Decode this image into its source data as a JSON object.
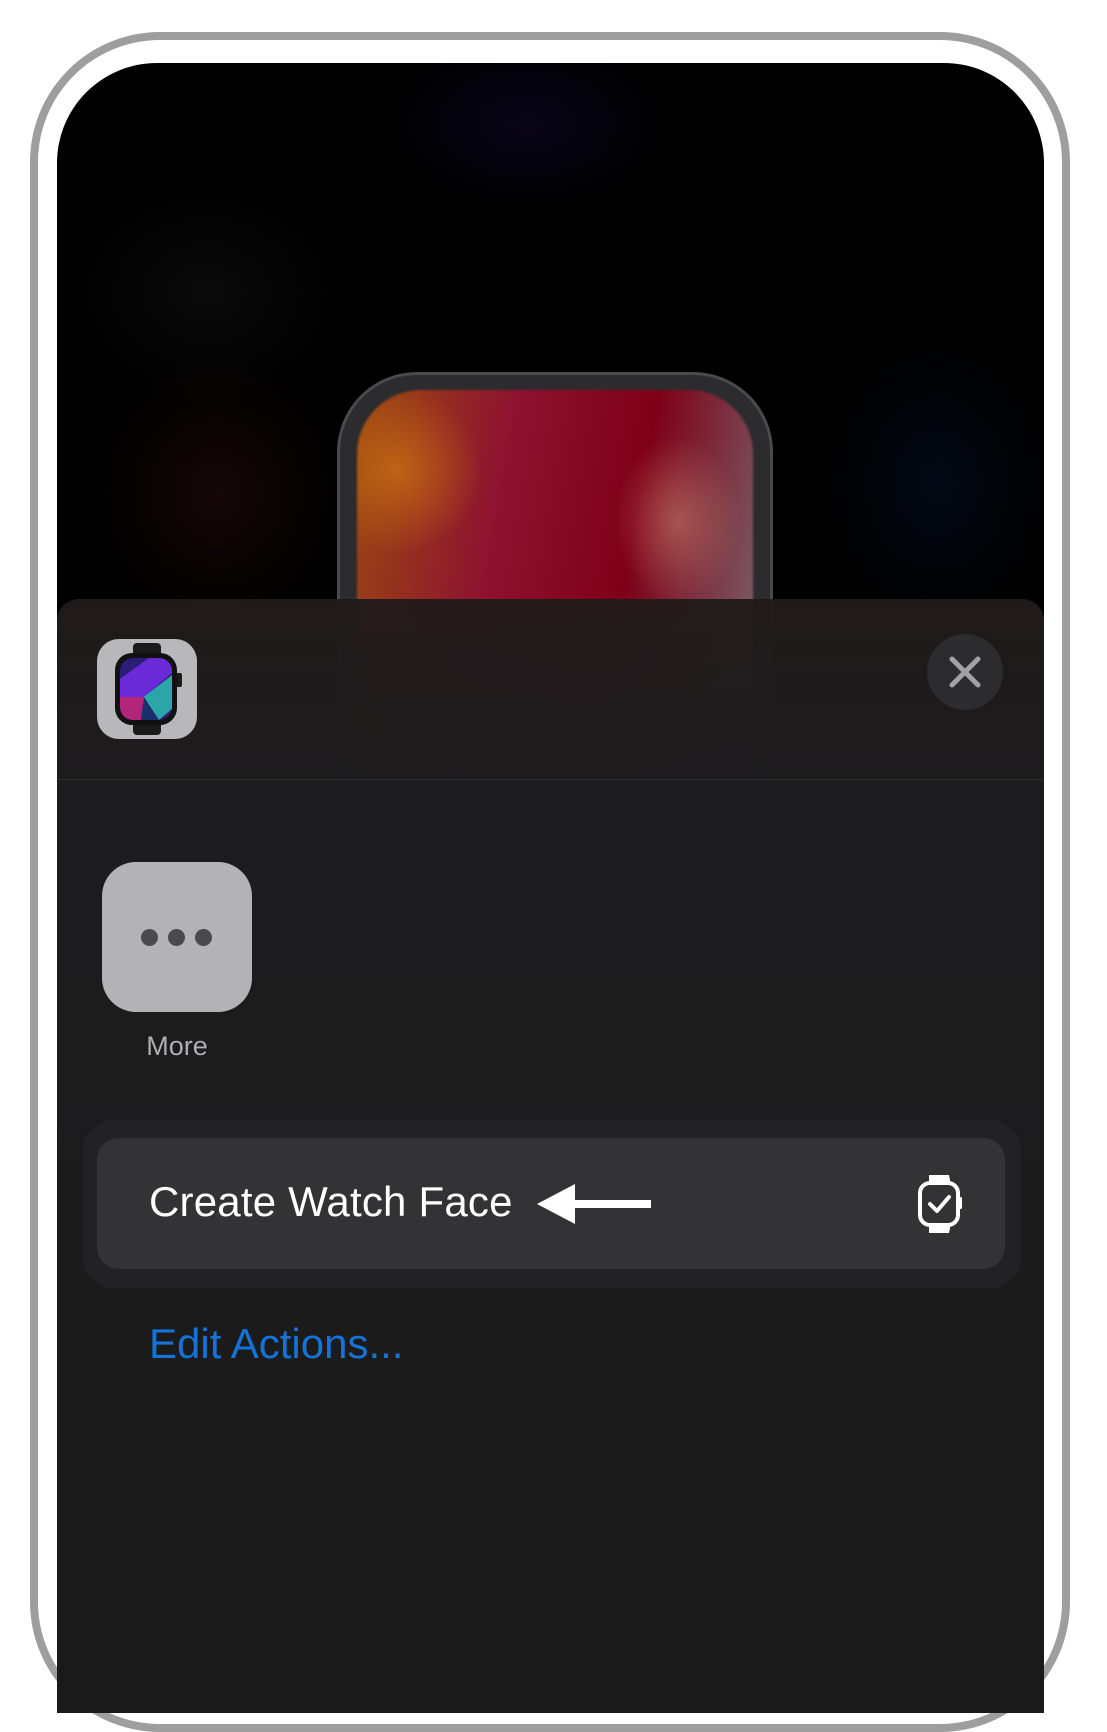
{
  "sheet": {
    "app_icon": "watch-app-icon",
    "close_icon": "close-icon"
  },
  "apps_row": {
    "items": [
      {
        "label": "More",
        "icon": "ellipsis-icon"
      }
    ]
  },
  "actions": {
    "items": [
      {
        "label": "Create Watch Face",
        "icon": "watch-face-icon",
        "annotation": "arrow-left-icon"
      }
    ],
    "edit_label": "Edit Actions..."
  },
  "colors": {
    "link": "#1473d9",
    "sheet_background": "#1c1c1e",
    "action_row": "#333335",
    "annotation_arrow": "#ffffff"
  }
}
